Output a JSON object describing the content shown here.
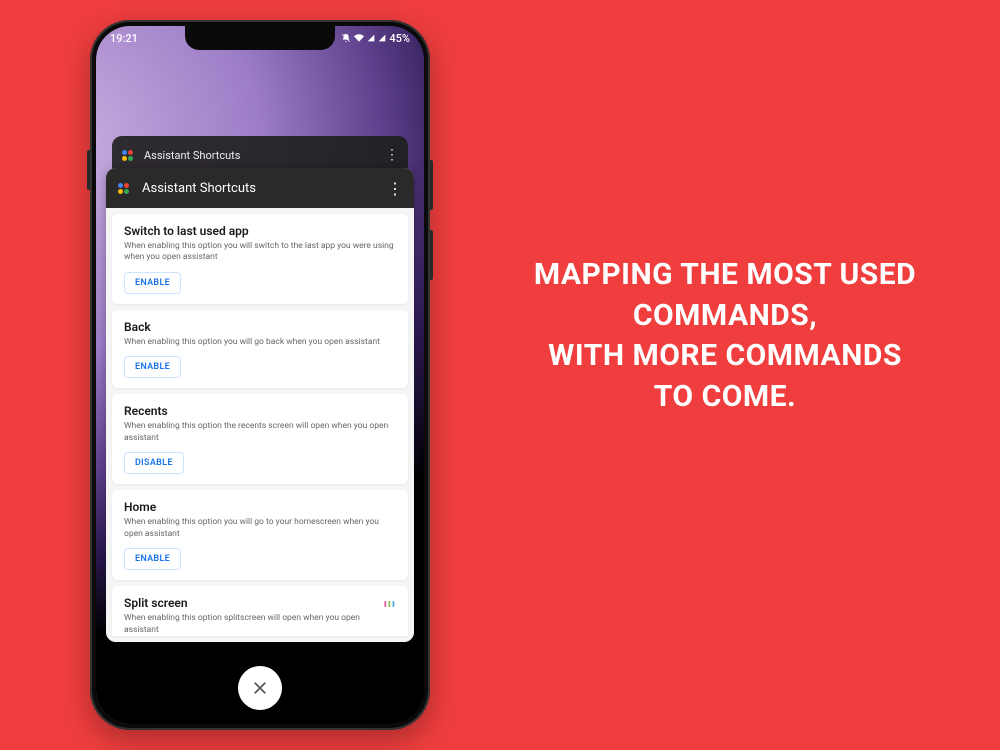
{
  "status": {
    "time": "19:21",
    "battery": "45%"
  },
  "back_card": {
    "title": "Assistant Shortcuts"
  },
  "app": {
    "title": "Assistant Shortcuts"
  },
  "options": [
    {
      "title": "Switch to last used app",
      "desc": "When enabling this option you will switch to the last app you were using when you open assistant",
      "action": "ENABLE"
    },
    {
      "title": "Back",
      "desc": "When enabling this option you will go back when you open assistant",
      "action": "ENABLE"
    },
    {
      "title": "Recents",
      "desc": "When enabling this option the recents screen will open when you open assistant",
      "action": "DISABLE"
    },
    {
      "title": "Home",
      "desc": "When enabling this option you will go to your homescreen when you open assistant",
      "action": "ENABLE"
    },
    {
      "title": "Split screen",
      "desc": "When enabling this option splitscreen will open when you open assistant",
      "action": ""
    }
  ],
  "headline": {
    "line1": "MAPPING THE MOST USED",
    "line2": "COMMANDS,",
    "line3": "WITH MORE COMMANDS",
    "line4": "TO COME."
  }
}
